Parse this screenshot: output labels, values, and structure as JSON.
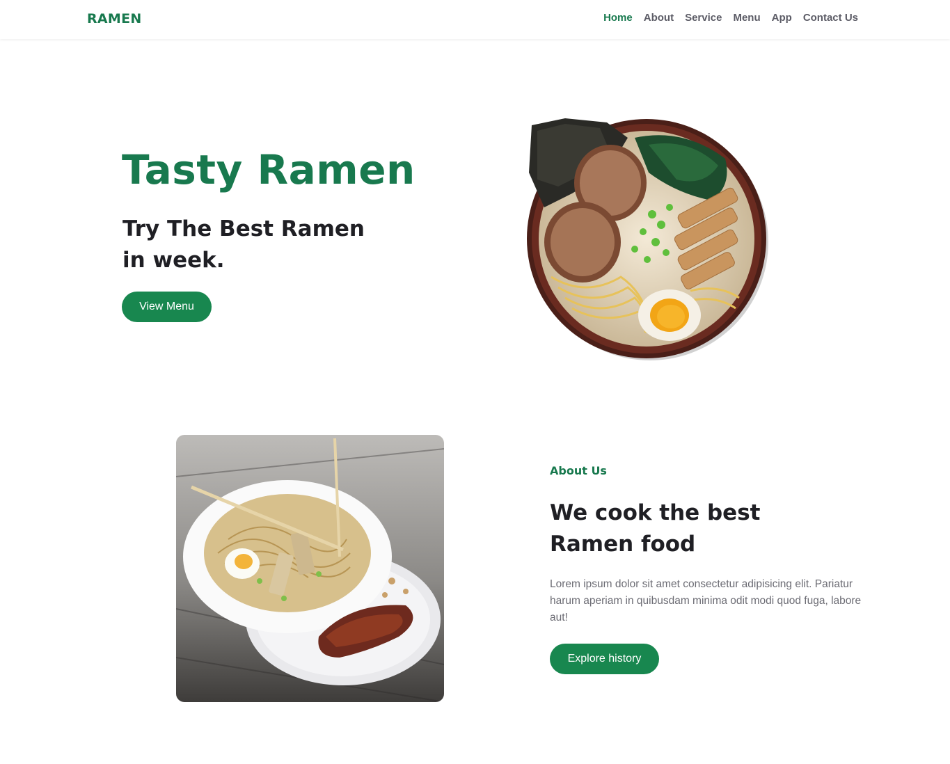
{
  "header": {
    "logo": "RAMEN",
    "nav": [
      "Home",
      "About",
      "Service",
      "Menu",
      "App",
      "Contact Us"
    ],
    "active_nav": "Home"
  },
  "hero": {
    "title": "Tasty Ramen",
    "subtitle_line1": "Try The Best Ramen",
    "subtitle_line2": "in week.",
    "button": "View Menu"
  },
  "about": {
    "label": "About Us",
    "title_line1": "We cook the best",
    "title_line2": "Ramen food",
    "text": "Lorem ipsum dolor sit amet consectetur adipisicing elit. Pariatur harum aperiam in quibusdam minima odit modi quod fuga, labore aut!",
    "button": "Explore history"
  },
  "colors": {
    "brand": "#18794e",
    "button": "#18874f",
    "text": "#1f1f24",
    "muted": "#6b6b73"
  }
}
